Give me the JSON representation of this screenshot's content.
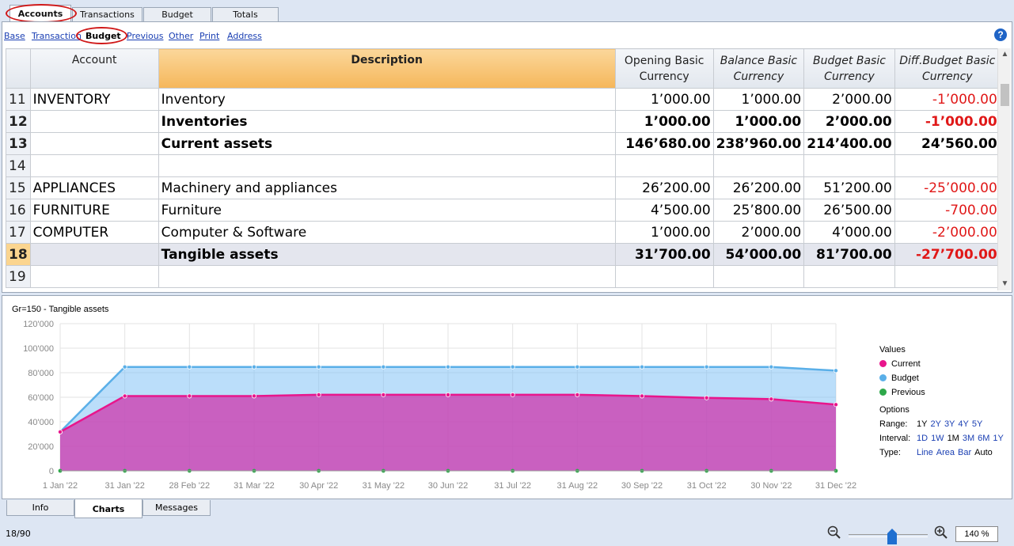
{
  "top_tabs": [
    "Accounts",
    "Transactions",
    "Budget",
    "Totals"
  ],
  "views": [
    "Base",
    "Transaction",
    "Budget",
    "Previous",
    "Other",
    "Print",
    "Address"
  ],
  "help_icon": "?",
  "columns": {
    "account": "Account",
    "description": "Description",
    "opening": [
      "Opening Basic",
      "Currency"
    ],
    "balance": [
      "Balance Basic",
      "Currency"
    ],
    "budget": [
      "Budget Basic",
      "Currency"
    ],
    "diff": [
      "Diff.Budget Basic",
      "Currency"
    ]
  },
  "rows": [
    {
      "n": "11",
      "account": "INVENTORY",
      "description": "Inventory",
      "opening": "1’000.00",
      "balance": "1’000.00",
      "budget": "2’000.00",
      "diff": "-1’000.00",
      "bold": false,
      "neg": true
    },
    {
      "n": "12",
      "account": "",
      "description": "Inventories",
      "opening": "1’000.00",
      "balance": "1’000.00",
      "budget": "2’000.00",
      "diff": "-1’000.00",
      "bold": true,
      "neg": true
    },
    {
      "n": "13",
      "account": "",
      "description": "Current assets",
      "opening": "146’680.00",
      "balance": "238’960.00",
      "budget": "214’400.00",
      "diff": "24’560.00",
      "bold": true,
      "neg": false
    },
    {
      "n": "14",
      "account": "",
      "description": "",
      "opening": "",
      "balance": "",
      "budget": "",
      "diff": "",
      "bold": false,
      "neg": false
    },
    {
      "n": "15",
      "account": "APPLIANCES",
      "description": "Machinery and appliances",
      "opening": "26’200.00",
      "balance": "26’200.00",
      "budget": "51’200.00",
      "diff": "-25’000.00",
      "bold": false,
      "neg": true
    },
    {
      "n": "16",
      "account": "FURNITURE",
      "description": "Furniture",
      "opening": "4’500.00",
      "balance": "25’800.00",
      "budget": "26’500.00",
      "diff": "-700.00",
      "bold": false,
      "neg": true
    },
    {
      "n": "17",
      "account": "COMPUTER",
      "description": "Computer & Software",
      "opening": "1’000.00",
      "balance": "2’000.00",
      "budget": "4’000.00",
      "diff": "-2’000.00",
      "bold": false,
      "neg": true
    },
    {
      "n": "18",
      "account": "",
      "description": "Tangible assets",
      "opening": "31’700.00",
      "balance": "54’000.00",
      "budget": "81’700.00",
      "diff": "-27’700.00",
      "bold": true,
      "neg": true,
      "selected": true
    },
    {
      "n": "19",
      "account": "",
      "description": "",
      "opening": "",
      "balance": "",
      "budget": "",
      "diff": "",
      "bold": false,
      "neg": false
    }
  ],
  "chart_data": {
    "type": "area",
    "title": "Gr=150 - Tangible assets",
    "categories": [
      "1 Jan '22",
      "31 Jan '22",
      "28 Feb '22",
      "31 Mar '22",
      "30 Apr '22",
      "31 May '22",
      "30 Jun '22",
      "31 Jul '22",
      "31 Aug '22",
      "30 Sep '22",
      "31 Oct '22",
      "30 Nov '22",
      "31 Dec '22"
    ],
    "y_ticks": [
      "0",
      "20'000",
      "40'000",
      "60'000",
      "80'000",
      "100'000",
      "120'000"
    ],
    "ylim": [
      0,
      120000
    ],
    "series": [
      {
        "name": "Current",
        "color": "#e8168c",
        "values": [
          31700,
          61000,
          61000,
          61000,
          62000,
          62000,
          62000,
          62000,
          62000,
          61000,
          59500,
          58500,
          54000
        ]
      },
      {
        "name": "Budget",
        "color": "#5aafe8",
        "values": [
          31700,
          84700,
          84700,
          84700,
          84700,
          84700,
          84700,
          84700,
          84700,
          84700,
          84700,
          84700,
          81700
        ]
      },
      {
        "name": "Previous",
        "color": "#2ea84a",
        "values": [
          0,
          0,
          0,
          0,
          0,
          0,
          0,
          0,
          0,
          0,
          0,
          0,
          0
        ]
      }
    ],
    "grid": true,
    "legend_placement": "right"
  },
  "legend": {
    "values_label": "Values",
    "options_label": "Options",
    "range_label": "Range:",
    "range_opts": [
      "1Y",
      "2Y",
      "3Y",
      "4Y",
      "5Y"
    ],
    "interval_label": "Interval:",
    "interval_opts": [
      "1D",
      "1W",
      "1M",
      "3M",
      "6M",
      "1Y"
    ],
    "type_label": "Type:",
    "type_opts": [
      "Line",
      "Area",
      "Bar",
      "Auto"
    ]
  },
  "bottom_tabs": [
    "Info",
    "Charts",
    "Messages"
  ],
  "status": "18/90",
  "zoom": "140 %",
  "zoom_level": 0.55
}
